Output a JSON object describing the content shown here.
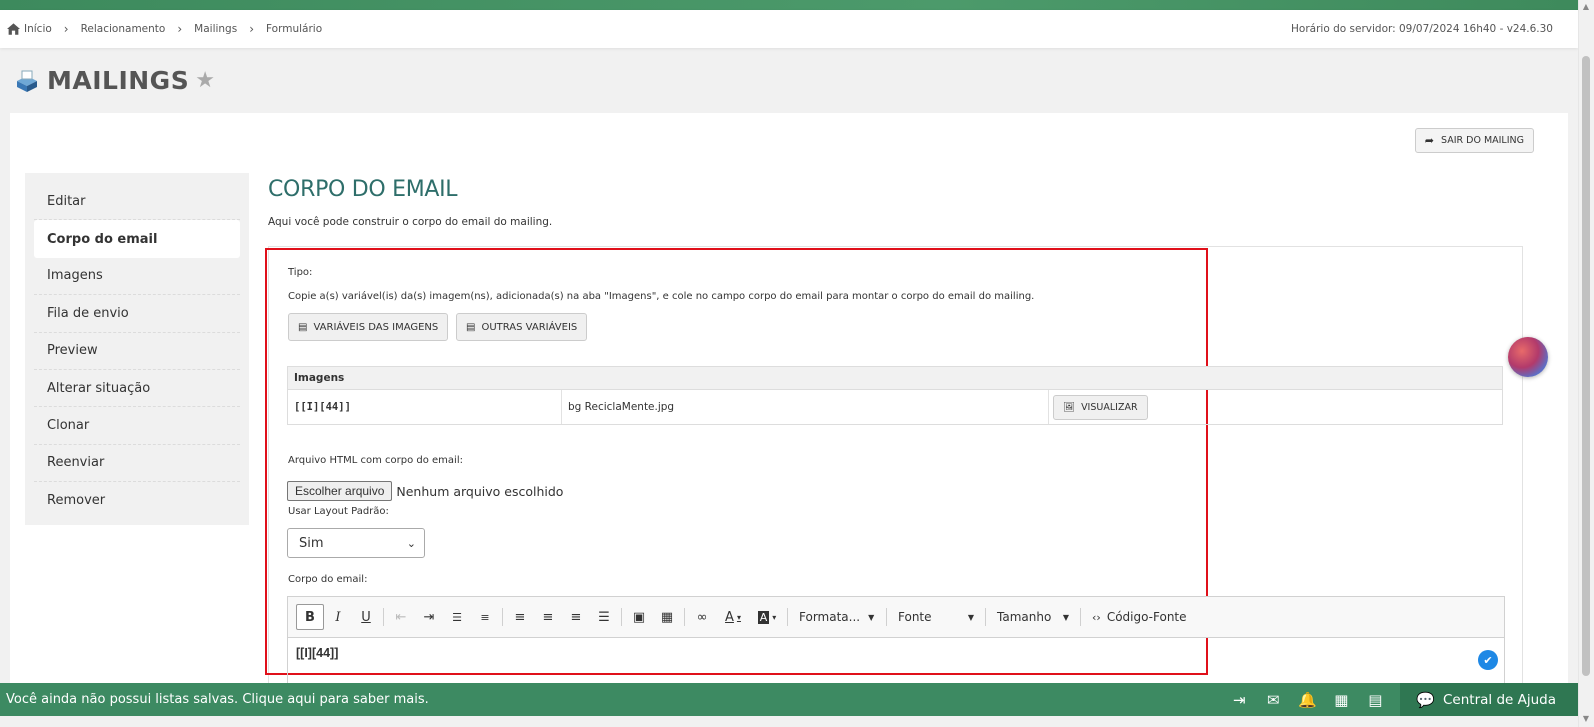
{
  "breadcrumb": {
    "items": [
      "Início",
      "Relacionamento",
      "Mailings",
      "Formulário"
    ]
  },
  "server_time": "Horário do servidor: 09/07/2024 16h40 - v24.6.30",
  "page": {
    "title": "MAILINGS"
  },
  "exit_button": "SAIR DO MAILING",
  "sidebar": {
    "items": [
      {
        "label": "Editar"
      },
      {
        "label": "Corpo do email"
      },
      {
        "label": "Imagens"
      },
      {
        "label": "Fila de envio"
      },
      {
        "label": "Preview"
      },
      {
        "label": "Alterar situação"
      },
      {
        "label": "Clonar"
      },
      {
        "label": "Reenviar"
      },
      {
        "label": "Remover"
      }
    ],
    "active_index": 1
  },
  "section": {
    "title": "CORPO DO EMAIL",
    "description": "Aqui você pode construir o corpo do email do mailing."
  },
  "form": {
    "tipo_label": "Tipo:",
    "instructions": "Copie a(s) variável(is) da(s) imagem(ns), adicionada(s) na aba \"Imagens\", e cole no campo corpo do email para montar o corpo do email do mailing.",
    "btn_image_vars": "VARIÁVEIS DAS IMAGENS",
    "btn_other_vars": "OUTRAS VARIÁVEIS",
    "images_table": {
      "header": "Imagens",
      "rows": [
        {
          "variable": "[[I][44]]",
          "file": "bg ReciclaMente.jpg",
          "action": "VISUALIZAR"
        }
      ]
    },
    "html_file_label": "Arquivo HTML com corpo do email:",
    "file_button": "Escolher arquivo",
    "file_status": "Nenhum arquivo escolhido",
    "layout_label": "Usar Layout Padrão:",
    "layout_value": "Sim",
    "body_label": "Corpo do email:",
    "editor": {
      "format_label": "Formata...",
      "font_label": "Fonte",
      "size_label": "Tamanho",
      "source_label": "Código-Fonte",
      "content": "[[I][44]]"
    }
  },
  "footer": {
    "message": "Você ainda não possui listas salvas. Clique aqui para saber mais.",
    "help_label": "Central de Ajuda"
  },
  "colors": {
    "accent_green": "#3d8a62",
    "title_teal": "#2e6e6a",
    "highlight_red": "#e0101a"
  }
}
